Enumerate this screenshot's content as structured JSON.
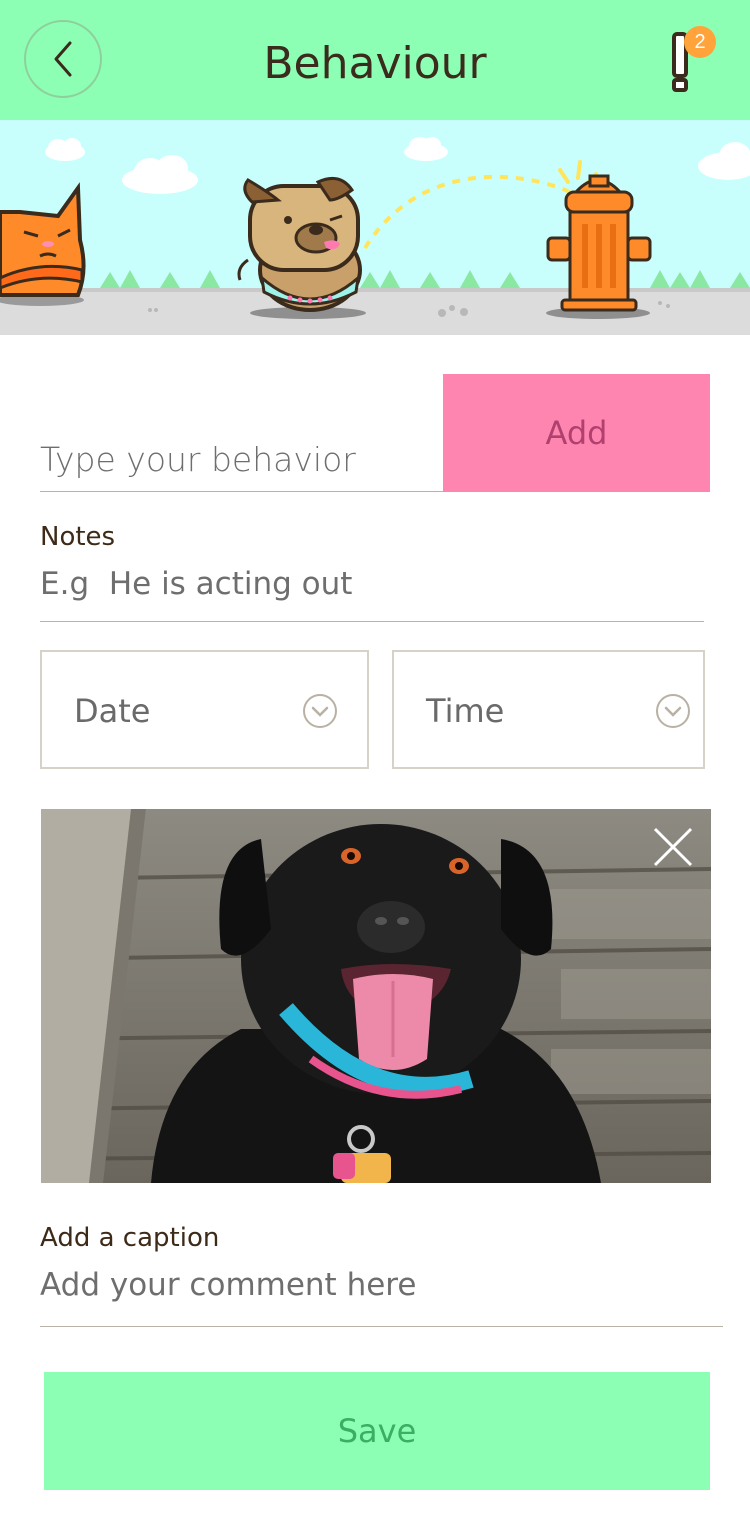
{
  "header": {
    "title": "Behaviour",
    "notification_count": "2",
    "back_icon": "chevron-left-icon",
    "alert_icon": "exclamation-icon"
  },
  "form": {
    "behavior_placeholder": "Type your behavior",
    "add_label": "Add",
    "notes_label": "Notes",
    "notes_placeholder": "E.g  He is acting out",
    "date_label": "Date",
    "time_label": "Time",
    "caption_label": "Add a caption",
    "caption_placeholder": "Add your comment here",
    "save_label": "Save"
  },
  "colors": {
    "header_bg": "#8cffb4",
    "add_button": "#ff85b1",
    "save_button": "#8cffb4",
    "badge": "#ffa33a",
    "banner_sky": "#c8fffd"
  }
}
